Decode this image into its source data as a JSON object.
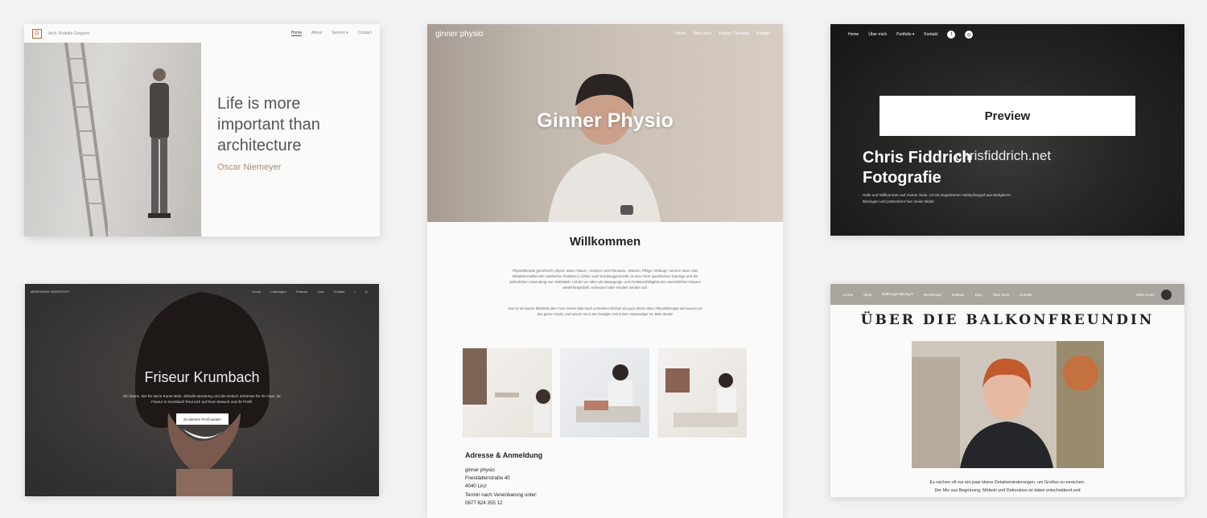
{
  "cards": {
    "architecture": {
      "brand": "Arch. Rodolfo Gregorio",
      "nav": [
        "Home",
        "About",
        "Service ▾",
        "Contact"
      ],
      "quote": "Life is more important than architecture",
      "author": "Oscar Niemeyer",
      "logo_mark": "G"
    },
    "physio": {
      "brand": "ginner physio",
      "nav": [
        "Home",
        "Über mich",
        "Praxis / Therapie",
        "Kontakt"
      ],
      "hero_title": "Ginner Physio",
      "welcome": "Willkommen",
      "para1": "Physiotherapie (griechisch: physis, etwa «Natur», «Körper» und therapeia, «Dienen, Pflege, Heilung»; somit in etwa «das Wiederherstellen der natürlichen Funktion»), bisher auch Krankengymnastik, ist eine Form spezifischen Trainings und der äußerlichen Anwendung von Heilmitteln, mit der vor allem die Bewegungs- und Funktionsfähigkeit des menschlichen Körpers wiederhergestellt, verbessert oder erhalten werden soll.",
      "para2": "Das ist ein kurzer Blindtext über Frau Ginner bitte noch schreiben! Einfach ein paar Worte übers Physiotherapie und warum sie das gerne macht, und warum sie in der heutigen Zeit immer notwendiger ist. Bitte danke!",
      "address_heading": "Adresse & Anmeldung",
      "address": [
        "ginner physio",
        "Freistädterstraße 40",
        "4040 Linz",
        "Termin nach Vereinbarung unter:",
        "0677 624 355 12"
      ]
    },
    "photo": {
      "nav": [
        "Home",
        "Über mich",
        "Portfolio ▾",
        "Kontakt"
      ],
      "preview": "Preview",
      "title_line1": "Chris Fiddrich",
      "title_line2": "Fotografie",
      "domain": "chrisfiddrich.net",
      "desc": "Hallo und Willkommen auf meiner Seite. Ich bin begeisterter Hobbyfotograf aus Bietigheim-Bissingen und präsentiere hier meine Bilder."
    },
    "friseur": {
      "brand": "MERKWERK WERKSTATT",
      "nav": [
        "Home",
        "Leistungen",
        "Friseure",
        "Jobs",
        "Kontakt"
      ],
      "title": "Friseur Krumbach",
      "sub": "Ein Name, der für seine Kunst steht. Stilvolle Beratung und die einfach Schönste für Ihr Haar. Ihr Friseur in Krumbach freut sich auf Ihren Besuch und Ihr Profil.",
      "button": "Zu deinem Profil weiter!"
    },
    "balkon": {
      "nav": [
        "Home",
        "Shop",
        "Balkongestaltung ▾",
        "Workshops",
        "Rabatte",
        "Blog",
        "Über mich",
        "Kontakt"
      ],
      "right_text": "Mein Konto",
      "title": "ÜBER DIE BALKONFREUNDIN",
      "text1": "Es reichen oft nur ein paar kleine Detailveränderungen, um Großes zu erreichen.",
      "text2": "Der Mix aus Begrünung, Möbeln und Dekoration ist dabei entscheidend und"
    }
  },
  "colors": {
    "page_bg": "#f2f2f2",
    "arch_accent": "#b5673a",
    "author": "#b08a6a",
    "balkon_nav": "#aaa59e"
  }
}
